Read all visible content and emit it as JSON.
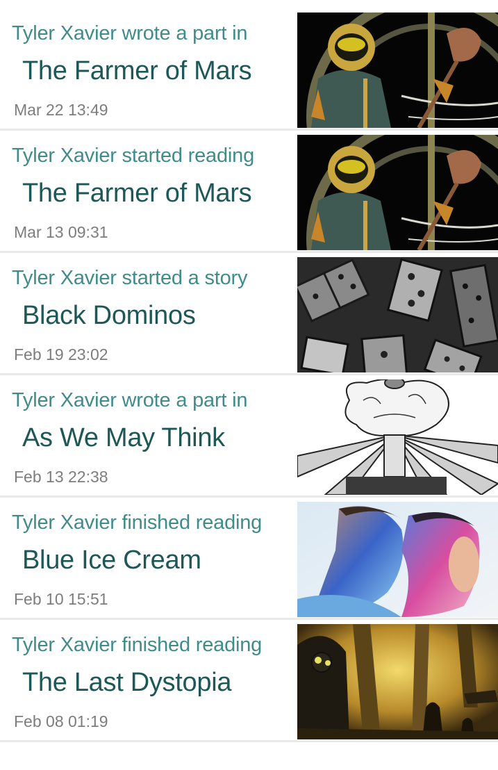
{
  "feed": {
    "items": [
      {
        "action": "Tyler Xavier wrote a part in",
        "title": "The Farmer of Mars",
        "timestamp": "Mar 22 13:49",
        "thumbnail": "astronaut-farmer-cover"
      },
      {
        "action": "Tyler Xavier started reading",
        "title": "The Farmer of Mars",
        "timestamp": "Mar 13 09:31",
        "thumbnail": "astronaut-farmer-cover"
      },
      {
        "action": "Tyler Xavier started a story",
        "title": "Black Dominos",
        "timestamp": "Feb 19 23:02",
        "thumbnail": "dominos-cover"
      },
      {
        "action": "Tyler Xavier wrote a part in",
        "title": "As We May Think",
        "timestamp": "Feb 13 22:38",
        "thumbnail": "brain-sketch-cover"
      },
      {
        "action": "Tyler Xavier finished reading",
        "title": "Blue Ice Cream",
        "timestamp": "Feb 10 15:51",
        "thumbnail": "painted-faces-cover"
      },
      {
        "action": "Tyler Xavier finished reading",
        "title": "The Last Dystopia",
        "timestamp": "Feb 08 01:19",
        "thumbnail": "dystopia-city-cover"
      }
    ]
  },
  "colors": {
    "action_text": "#3f8c8a",
    "title_text": "#1e5856",
    "timestamp_text": "#7d7d7d",
    "divider": "#e8e8e8"
  }
}
